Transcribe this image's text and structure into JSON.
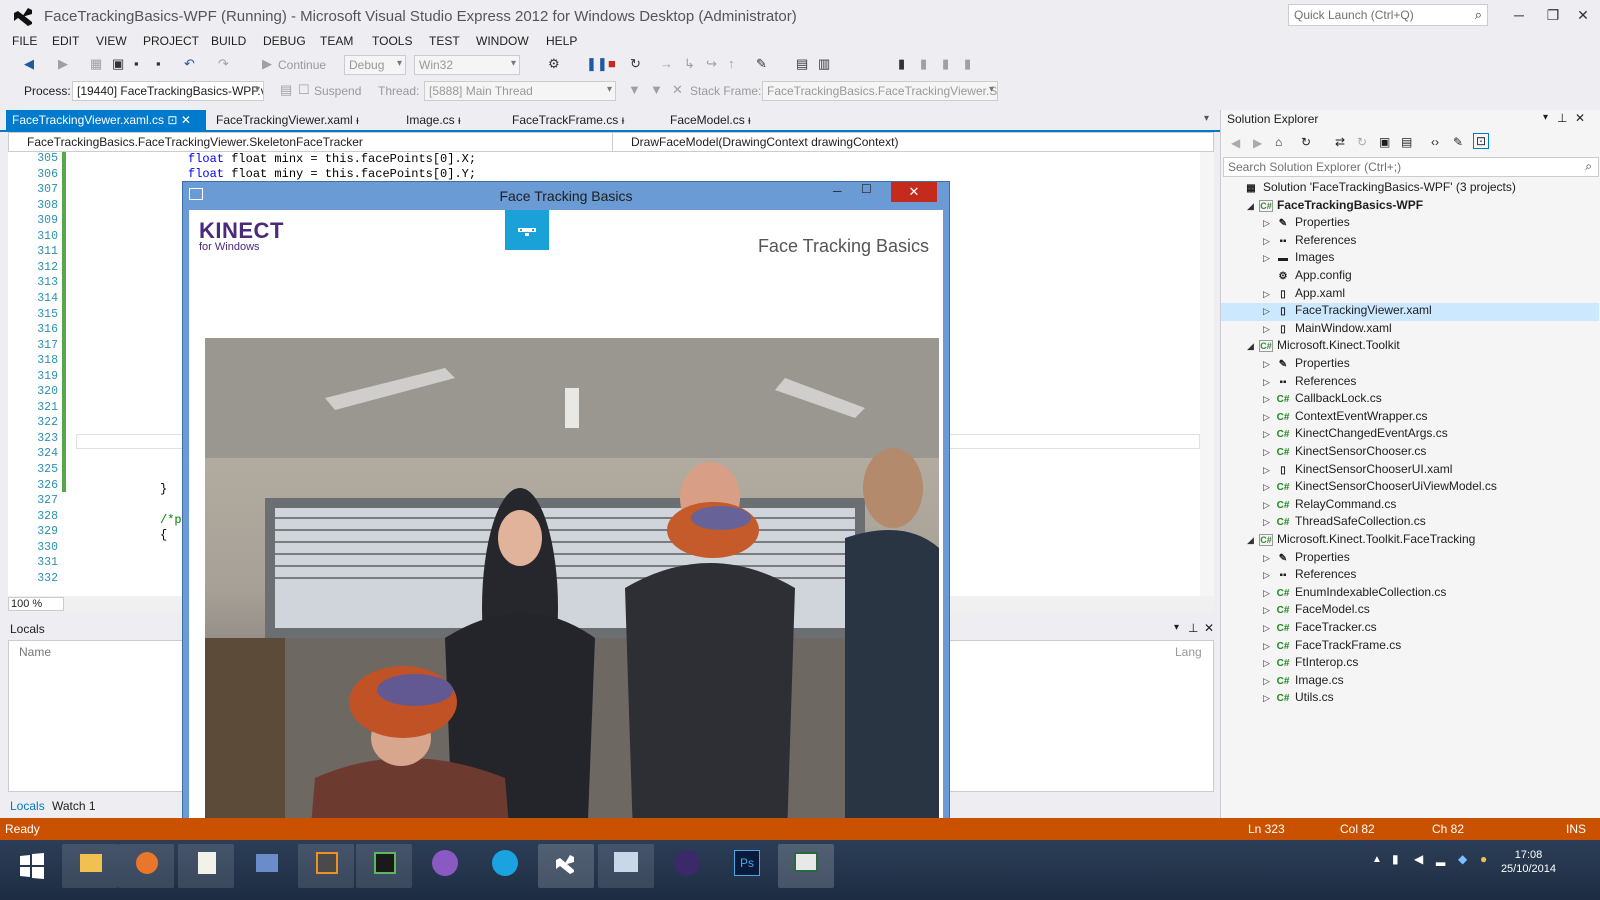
{
  "window": {
    "title": "FaceTrackingBasics-WPF (Running) - Microsoft Visual Studio Express 2012 for Windows Desktop (Administrator)",
    "quick_launch_placeholder": "Quick Launch (Ctrl+Q)"
  },
  "menu": [
    "FILE",
    "EDIT",
    "VIEW",
    "PROJECT",
    "BUILD",
    "DEBUG",
    "TEAM",
    "TOOLS",
    "TEST",
    "WINDOW",
    "HELP"
  ],
  "toolbar": {
    "continue_label": "Continue",
    "config": "Debug",
    "platform": "Win32",
    "process_label": "Process:",
    "process_value": "[19440] FaceTrackingBasics-WPF.v",
    "suspend_label": "Suspend",
    "thread_label": "Thread:",
    "thread_value": "[5888] Main Thread",
    "stack_label": "Stack Frame:",
    "stack_value": "FaceTrackingBasics.FaceTrackingViewer.S"
  },
  "tabs": [
    {
      "label": "FaceTrackingViewer.xaml.cs",
      "active": true
    },
    {
      "label": "FaceTrackingViewer.xaml",
      "active": false
    },
    {
      "label": "Image.cs",
      "active": false
    },
    {
      "label": "FaceTrackFrame.cs",
      "active": false
    },
    {
      "label": "FaceModel.cs",
      "active": false
    }
  ],
  "nav": {
    "left": "FaceTrackingBasics.FaceTrackingViewer.SkeletonFaceTracker",
    "right": "DrawFaceModel(DrawingContext drawingContext)"
  },
  "editor": {
    "line_numbers": [
      "305",
      "306",
      "307",
      "308",
      "309",
      "310",
      "311",
      "312",
      "313",
      "314",
      "315",
      "316",
      "317",
      "318",
      "319",
      "320",
      "321",
      "322",
      "323",
      "324",
      "325",
      "326",
      "327",
      "328",
      "329",
      "330",
      "331",
      "332"
    ],
    "line_305": "float minx = this.facePoints[0].X;",
    "line_306": "float miny = this.facePoints[0].Y;",
    "line_326": "}",
    "line_328": "/*p",
    "line_329": "{",
    "zoom": "100 %"
  },
  "locals": {
    "title": "Locals",
    "col_name": "Name",
    "col_lang": "Lang",
    "tabs": [
      "Locals",
      "Watch 1"
    ]
  },
  "solution_explorer": {
    "title": "Solution Explorer",
    "search_placeholder": "Search Solution Explorer (Ctrl+;)",
    "nodes": [
      {
        "label": "Solution 'FaceTrackingBasics-WPF' (3 projects)",
        "icon": "solution"
      },
      {
        "label": "FaceTrackingBasics-WPF",
        "icon": "project",
        "bold": true
      },
      {
        "label": "Properties",
        "icon": "wrench"
      },
      {
        "label": "References",
        "icon": "references"
      },
      {
        "label": "Images",
        "icon": "folder"
      },
      {
        "label": "App.config",
        "icon": "config"
      },
      {
        "label": "App.xaml",
        "icon": "xaml"
      },
      {
        "label": "FaceTrackingViewer.xaml",
        "icon": "xaml",
        "selected": true
      },
      {
        "label": "MainWindow.xaml",
        "icon": "xaml"
      },
      {
        "label": "Microsoft.Kinect.Toolkit",
        "icon": "project"
      },
      {
        "label": "Properties",
        "icon": "wrench"
      },
      {
        "label": "References",
        "icon": "references"
      },
      {
        "label": "CallbackLock.cs",
        "icon": "cs"
      },
      {
        "label": "ContextEventWrapper.cs",
        "icon": "cs"
      },
      {
        "label": "KinectChangedEventArgs.cs",
        "icon": "cs"
      },
      {
        "label": "KinectSensorChooser.cs",
        "icon": "cs"
      },
      {
        "label": "KinectSensorChooserUI.xaml",
        "icon": "xaml"
      },
      {
        "label": "KinectSensorChooserUiViewModel.cs",
        "icon": "cs"
      },
      {
        "label": "RelayCommand.cs",
        "icon": "cs"
      },
      {
        "label": "ThreadSafeCollection.cs",
        "icon": "cs"
      },
      {
        "label": "Microsoft.Kinect.Toolkit.FaceTracking",
        "icon": "project"
      },
      {
        "label": "Properties",
        "icon": "wrench"
      },
      {
        "label": "References",
        "icon": "references"
      },
      {
        "label": "EnumIndexableCollection.cs",
        "icon": "cs"
      },
      {
        "label": "FaceModel.cs",
        "icon": "cs"
      },
      {
        "label": "FaceTracker.cs",
        "icon": "cs"
      },
      {
        "label": "FaceTrackFrame.cs",
        "icon": "cs"
      },
      {
        "label": "FtInterop.cs",
        "icon": "cs"
      },
      {
        "label": "Image.cs",
        "icon": "cs"
      },
      {
        "label": "Utils.cs",
        "icon": "cs"
      }
    ]
  },
  "status": {
    "ready": "Ready",
    "ln": "Ln 323",
    "col": "Col 82",
    "ch": "Ch 82",
    "ins": "INS"
  },
  "face_window": {
    "title": "Face Tracking Basics",
    "brand": "KINECT",
    "brand_sub": "for Windows",
    "heading": "Face Tracking Basics"
  },
  "taskbar": {
    "time": "17:08",
    "date": "25/10/2014"
  },
  "colors": {
    "accent": "#007acc",
    "status": "#ca5100",
    "kinect_blue": "#19a1d8",
    "kinect_purple": "#4a2a7a"
  }
}
